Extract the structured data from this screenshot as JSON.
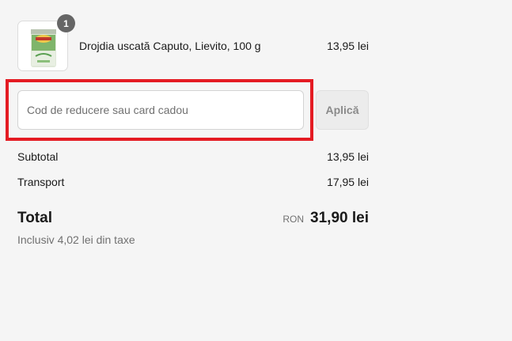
{
  "cart": {
    "item": {
      "quantity": "1",
      "name": "Drojdia uscată Caputo, Lievito, 100 g",
      "price": "13,95 lei",
      "image_icon": "yeast-can-icon"
    }
  },
  "discount": {
    "placeholder": "Cod de reducere sau card cadou",
    "value": "",
    "apply_label": "Aplică"
  },
  "summary": {
    "subtotal_label": "Subtotal",
    "subtotal_value": "13,95 lei",
    "shipping_label": "Transport",
    "shipping_value": "17,95 lei",
    "total_label": "Total",
    "currency": "RON",
    "total_value": "31,90 lei",
    "tax_note": "Inclusiv 4,02 lei din taxe"
  },
  "colors": {
    "highlight": "#e41b23",
    "background": "#f5f5f5",
    "badge": "#666666"
  }
}
